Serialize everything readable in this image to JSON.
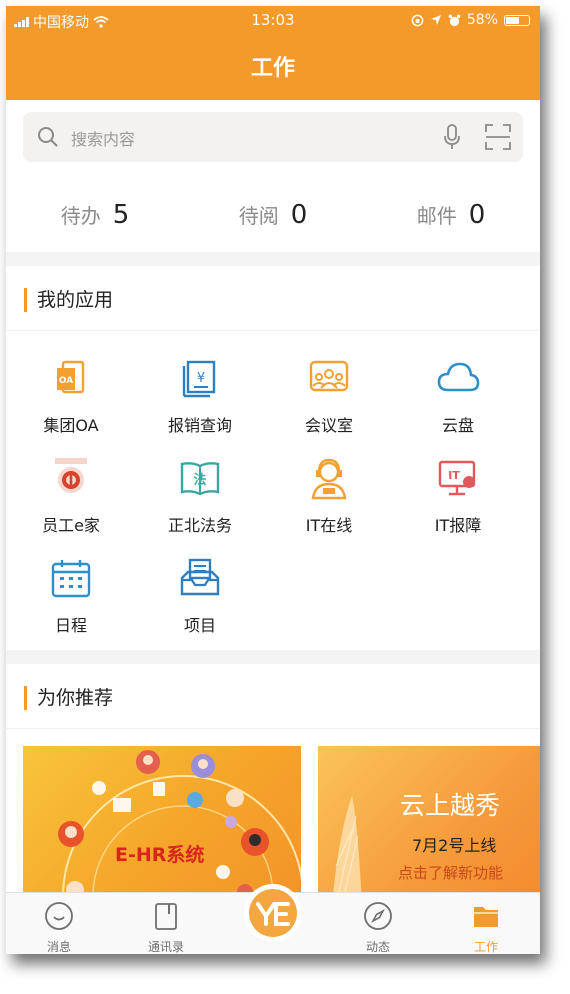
{
  "status": {
    "carrier": "中国移动",
    "time": "13:03",
    "battery": "58%"
  },
  "header": {
    "title": "工作"
  },
  "search": {
    "placeholder": "搜索内容"
  },
  "counters": [
    {
      "label": "待办",
      "value": "5"
    },
    {
      "label": "待阅",
      "value": "0"
    },
    {
      "label": "邮件",
      "value": "0"
    }
  ],
  "apps": {
    "title": "我的应用",
    "items": [
      {
        "label": "集团OA",
        "icon": "oa-icon"
      },
      {
        "label": "报销查询",
        "icon": "receipt-icon"
      },
      {
        "label": "会议室",
        "icon": "meeting-room-icon"
      },
      {
        "label": "云盘",
        "icon": "cloud-icon"
      },
      {
        "label": "员工e家",
        "icon": "emblem-icon"
      },
      {
        "label": "正北法务",
        "icon": "law-book-icon"
      },
      {
        "label": "IT在线",
        "icon": "support-agent-icon"
      },
      {
        "label": "IT报障",
        "icon": "it-monitor-icon"
      },
      {
        "label": "日程",
        "icon": "calendar-icon"
      },
      {
        "label": "项目",
        "icon": "inbox-icon"
      }
    ]
  },
  "recommend": {
    "title": "为你推荐",
    "banner1": {
      "text": "E-HR系统"
    },
    "banner2": {
      "title": "云上越秀",
      "date": "7月2号上线",
      "sub": "点击了解新功能"
    }
  },
  "tabs": [
    {
      "label": "消息",
      "icon": "message-icon"
    },
    {
      "label": "通讯录",
      "icon": "contacts-icon"
    },
    {
      "label": "动态",
      "icon": "compass-icon"
    },
    {
      "label": "工作",
      "icon": "folder-icon"
    }
  ],
  "colors": {
    "accent": "#f39a2b"
  }
}
